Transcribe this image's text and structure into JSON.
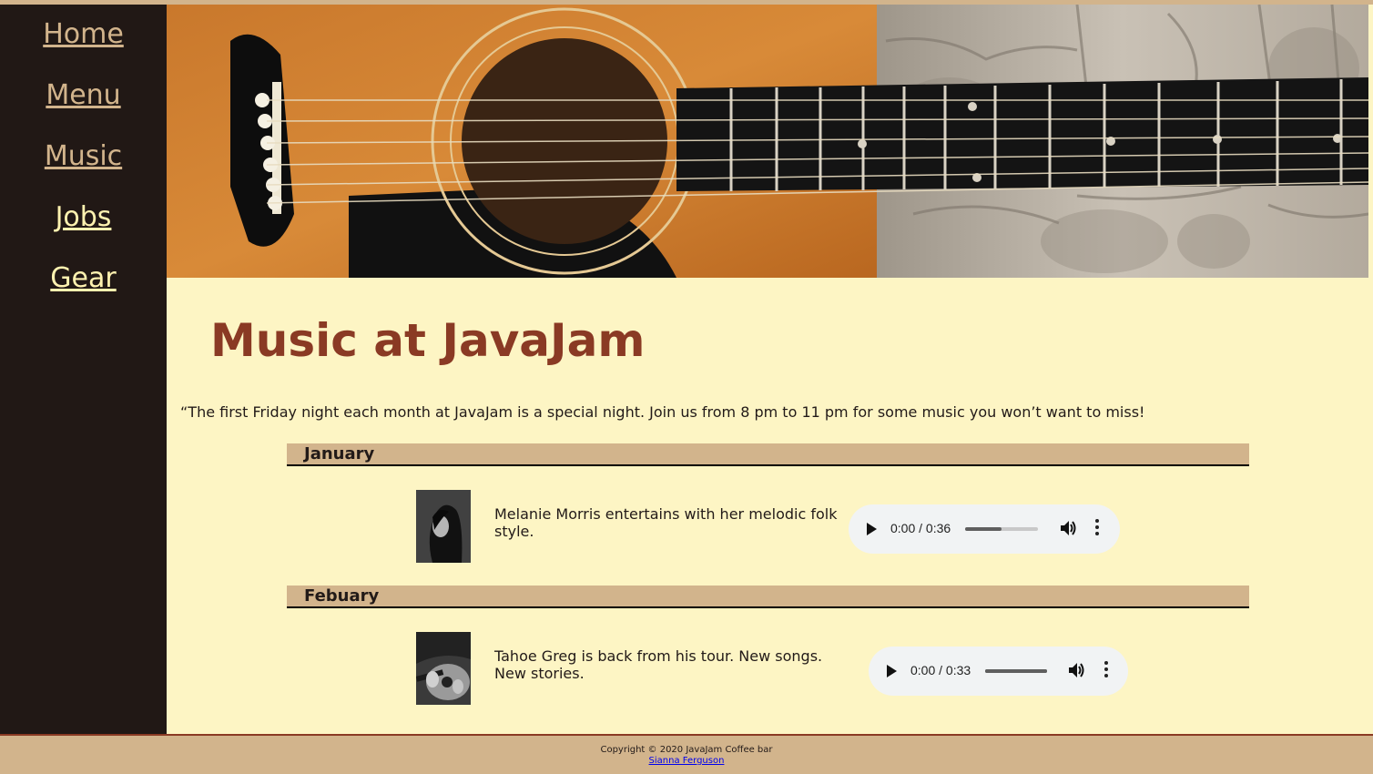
{
  "nav": {
    "items": [
      {
        "label": "Home",
        "color": "#d2b48c"
      },
      {
        "label": "Menu",
        "color": "#d2b48c"
      },
      {
        "label": "Music",
        "color": "#d2b48c"
      },
      {
        "label": "Jobs",
        "color": "#fff2b0"
      },
      {
        "label": "Gear",
        "color": "#fff2b0"
      }
    ]
  },
  "hero": {
    "icon": "guitar-hero-image"
  },
  "page": {
    "title": "Music at JavaJam",
    "intro": "“The first Friday night each month at JavaJam is a special night. Join us from 8 pm to 11 pm for some music you won’t want to miss!"
  },
  "events": [
    {
      "month": "January",
      "description": "Melanie Morris entertains with her melodic folk style.",
      "audio_time": "0:00 / 0:36",
      "volume_level": 0.5
    },
    {
      "month": "Febuary",
      "description": "Tahoe Greg is back from his tour. New songs. New stories.",
      "audio_time": "0:00 / 0:33",
      "volume_level": 1.0
    }
  ],
  "footer": {
    "copyright": "Copyright © 2020 JavaJam Coffee bar",
    "author_link": "Sianna Ferguson"
  },
  "colors": {
    "sidebar": "#211815",
    "main_bg": "#fdf5c4",
    "tan": "#d2b48c",
    "title": "#8a3a24"
  }
}
